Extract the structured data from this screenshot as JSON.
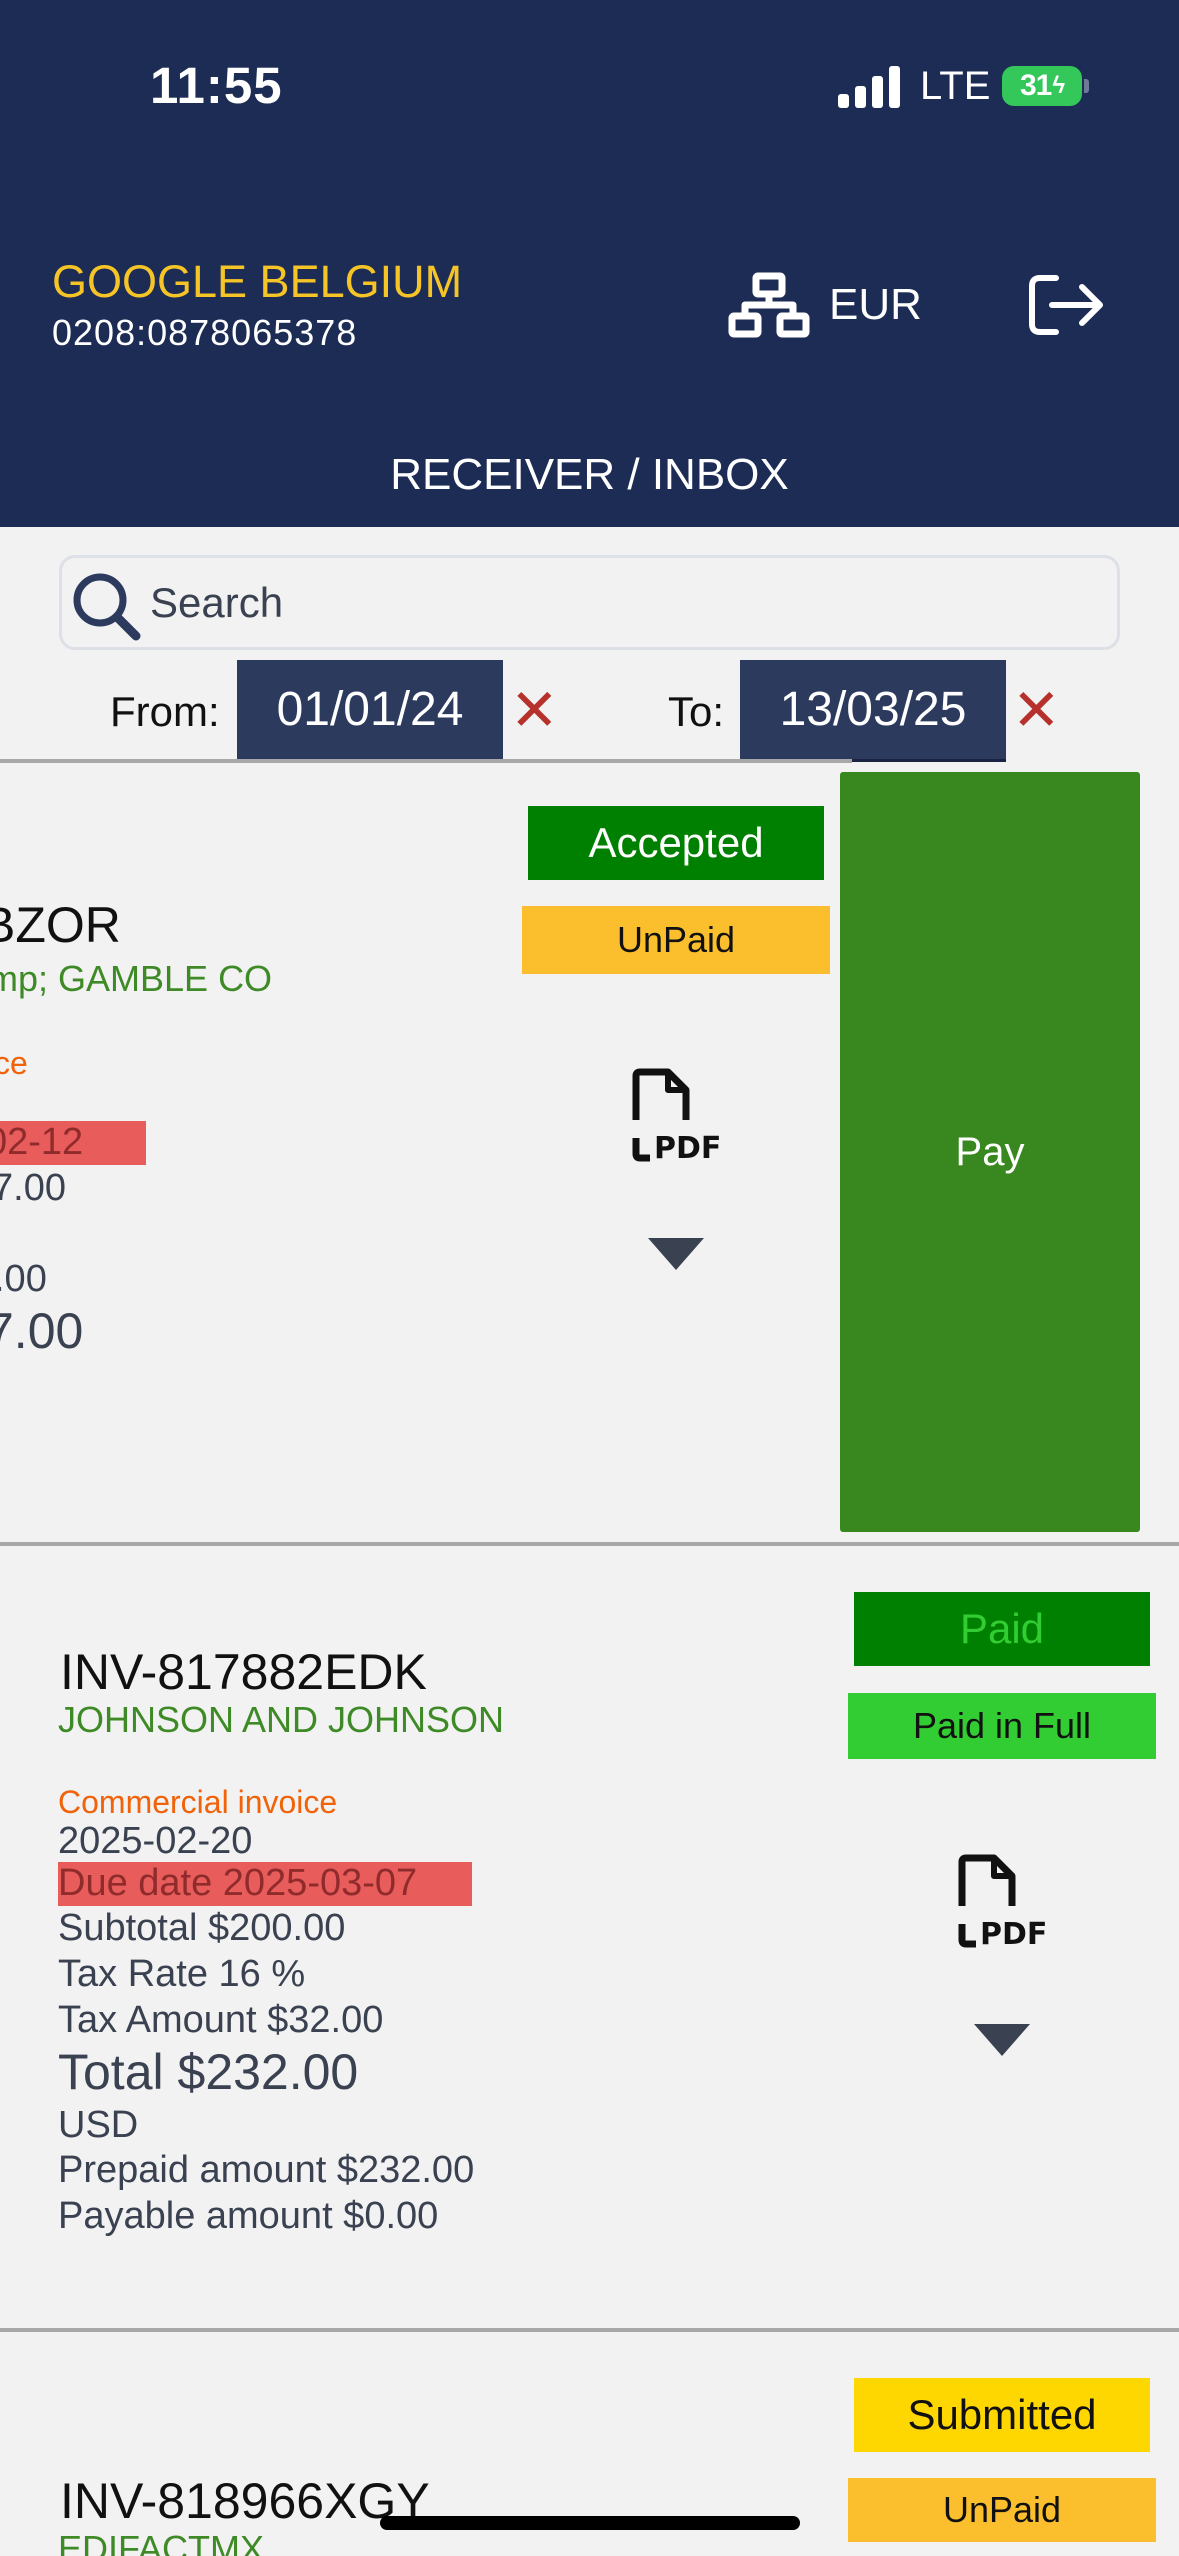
{
  "status_bar": {
    "time": "11:55",
    "network": "LTE",
    "battery": "31"
  },
  "header": {
    "company": "GOOGLE BELGIUM",
    "participant_id": "0208:0878065378",
    "currency": "EUR",
    "network_icon": "network-icon",
    "logout_icon": "logout-icon",
    "title": "RECEIVER / INBOX"
  },
  "search": {
    "placeholder": "Search"
  },
  "filter": {
    "from_label": "From:",
    "from_value": "01/01/24",
    "to_label": "To:",
    "to_value": "13/03/25",
    "clear_symbol": "✕"
  },
  "invoices": [
    {
      "number": "BZOR",
      "customer": "mp; GAMBLE CO",
      "type": "ce",
      "due_date": "02-12",
      "subtotal": "7.00",
      "tax_amount": ".00",
      "total": "7.00",
      "status": "Accepted",
      "payment_status": "UnPaid",
      "action": "Pay"
    },
    {
      "number": "INV-817882EDK",
      "customer": "JOHNSON AND JOHNSON",
      "type": "Commercial invoice",
      "issue_date": "2025-02-20",
      "due_date": "Due date 2025-03-07",
      "subtotal": "Subtotal $200.00",
      "tax_rate": "Tax Rate 16 %",
      "tax_amount": "Tax Amount $32.00",
      "total": "Total $232.00",
      "currency": "USD",
      "prepaid": "Prepaid amount $232.00",
      "payable": "Payable amount $0.00",
      "status": "Paid",
      "payment_status": "Paid in Full"
    },
    {
      "number": "INV-818966XGY",
      "customer": "EDIFACTMX",
      "status": "Submitted",
      "payment_status": "UnPaid"
    }
  ],
  "colors": {
    "header_bg": "#1d2c55",
    "company": "#f5c426",
    "accepted": "#008000",
    "unpaid": "#fbbf2e",
    "paid_text": "#32cd32",
    "paid_in_full": "#32cd32",
    "submitted": "#ffd700",
    "pay_button": "#38871f",
    "due_highlight": "#e85c5c"
  }
}
